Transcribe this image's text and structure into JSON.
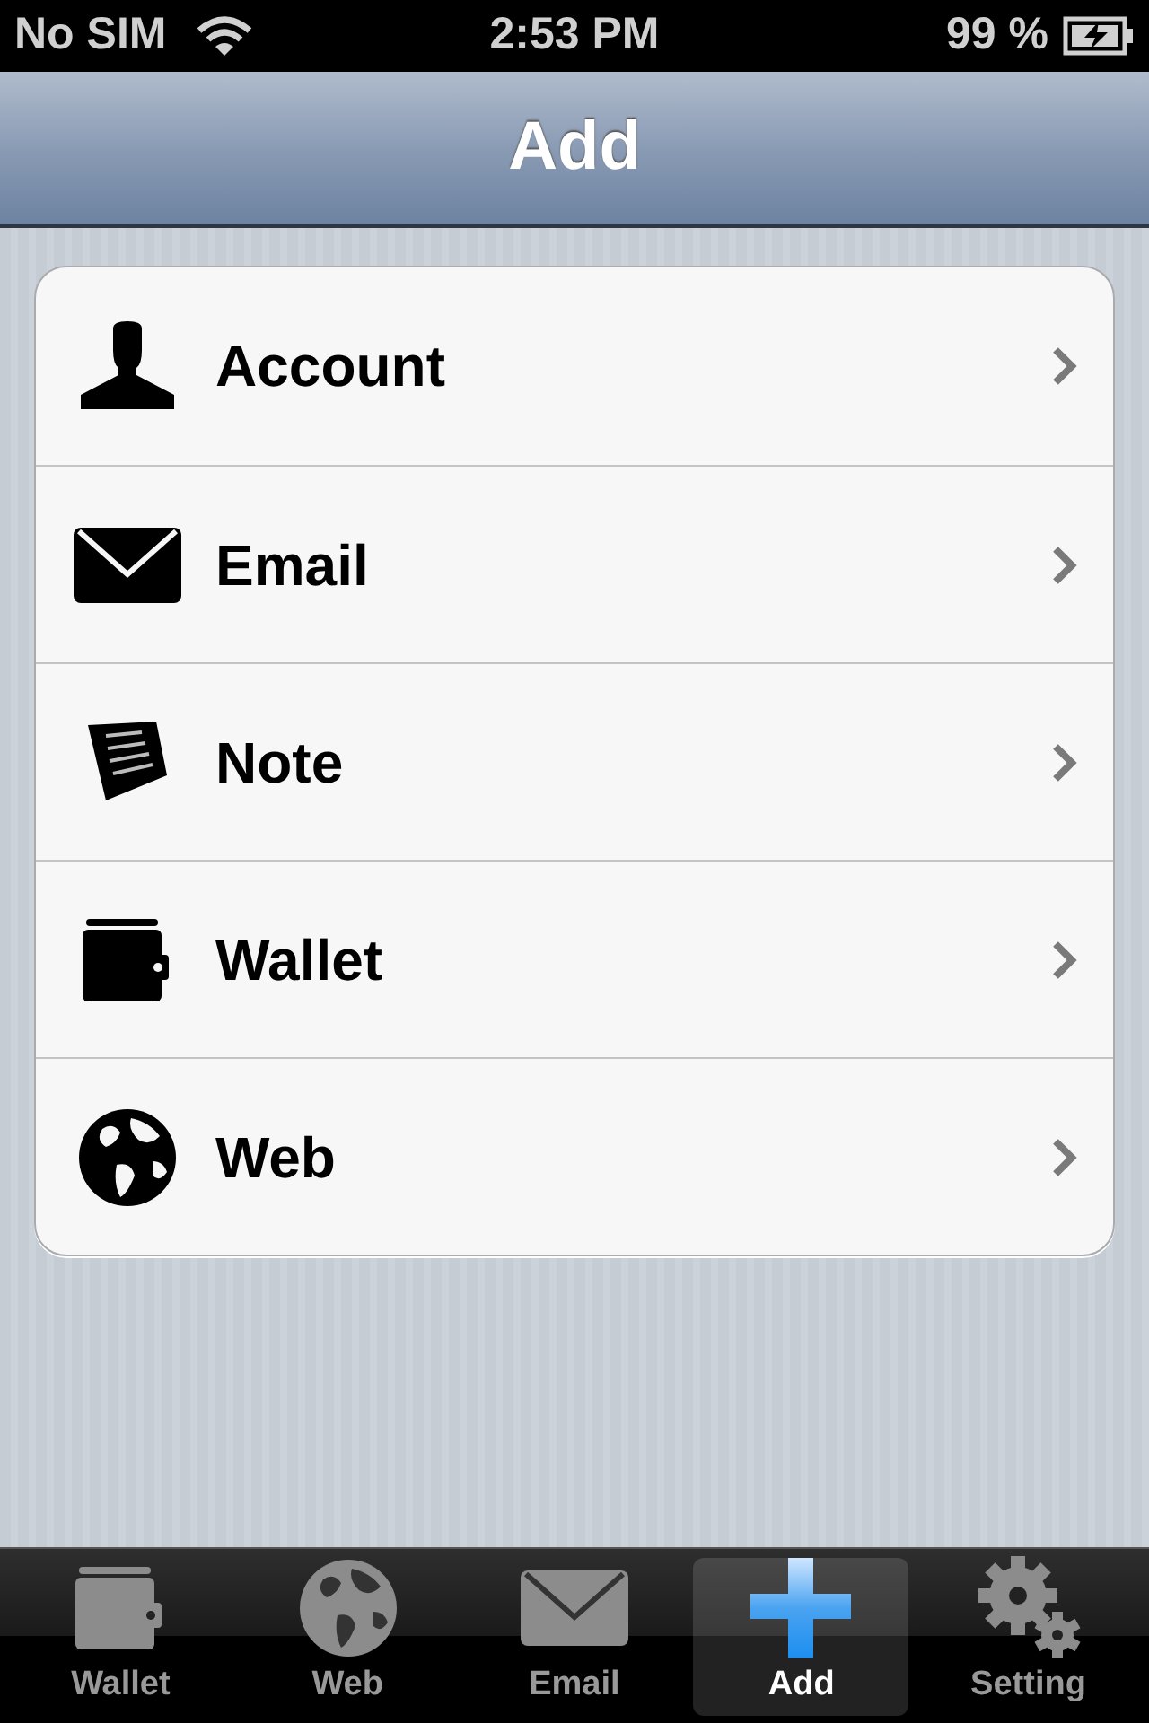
{
  "status_bar": {
    "carrier": "No SIM",
    "time": "2:53 PM",
    "battery": "99 %"
  },
  "nav_bar": {
    "title": "Add"
  },
  "items": [
    {
      "label": "Account"
    },
    {
      "label": "Email"
    },
    {
      "label": "Note"
    },
    {
      "label": "Wallet"
    },
    {
      "label": "Web"
    }
  ],
  "tab_bar": [
    {
      "label": "Wallet",
      "selected": false
    },
    {
      "label": "Web",
      "selected": false
    },
    {
      "label": "Email",
      "selected": false
    },
    {
      "label": "Add",
      "selected": true
    },
    {
      "label": "Setting",
      "selected": false
    }
  ]
}
